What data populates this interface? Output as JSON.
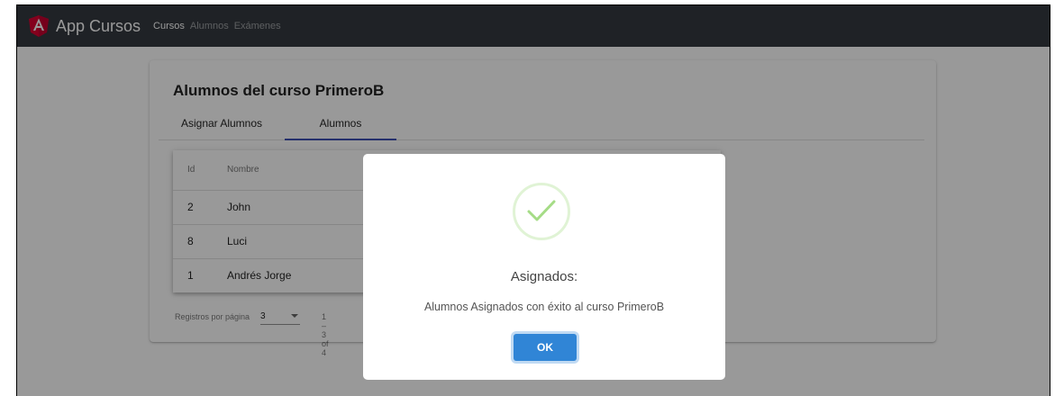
{
  "navbar": {
    "brand": "App Cursos",
    "links": [
      "Cursos",
      "Alumnos",
      "Exámenes"
    ]
  },
  "page": {
    "title": "Alumnos del curso PrimeroB",
    "tabs": [
      "Asignar Alumnos",
      "Alumnos"
    ],
    "active_tab": "Alumnos"
  },
  "table": {
    "columns": [
      "Id",
      "Nombre"
    ],
    "rows": [
      {
        "id": "2",
        "nombre": "John"
      },
      {
        "id": "8",
        "nombre": "Luci"
      },
      {
        "id": "1",
        "nombre": "Andrés Jorge"
      }
    ]
  },
  "paginator": {
    "label": "Registros por página",
    "page_size": "3",
    "range": "1 – 3 of 4"
  },
  "modal": {
    "title": "Asignados:",
    "text": "Alumnos Asignados con éxito al curso PrimeroB",
    "ok_label": "OK",
    "icon": "success-check-icon"
  },
  "colors": {
    "navbar_bg": "#343a40",
    "tab_indicator": "#3f51b5",
    "ok_button": "#3085d6",
    "success_check": "#a5dc86"
  }
}
